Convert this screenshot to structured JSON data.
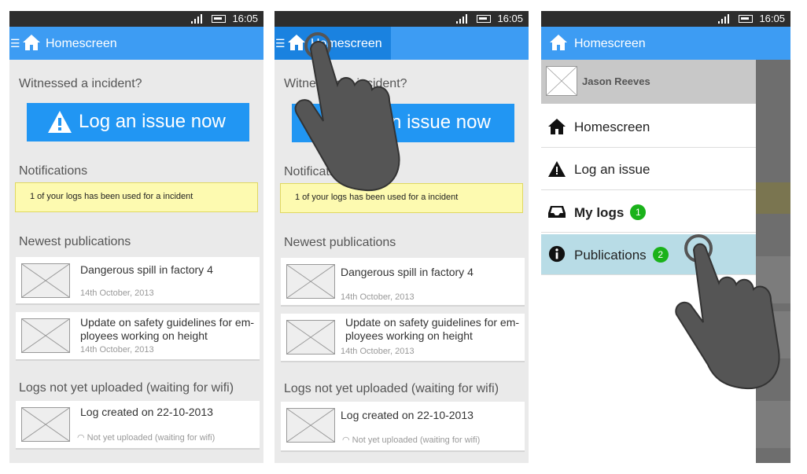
{
  "status": {
    "time": "16:05"
  },
  "appbar": {
    "title": "Homescreen",
    "menu_glyph": "☰"
  },
  "home": {
    "witness_heading": "Witnessed a incident?",
    "log_button": "Log an issue now",
    "notifications_heading": "Notifications",
    "notification_text": "1 of your logs has been used for a incident",
    "publications_heading": "Newest publications",
    "publications": [
      {
        "title": "Dangerous spill in factory 4",
        "date": "14th October, 2013"
      },
      {
        "title": "Update on safety guidelines for em-ployees working on height",
        "date": "14th October, 2013"
      }
    ],
    "pending_heading": "Logs not yet uploaded (waiting for wifi)",
    "pending": [
      {
        "title": "Log created on 22-10-2013",
        "status": "Not yet uploaded (waiting for wifi)"
      }
    ]
  },
  "drawer": {
    "user_name": "Jason Reeves",
    "items": [
      {
        "label": "Homescreen",
        "icon": "home-icon"
      },
      {
        "label": "Log an issue",
        "icon": "warning-icon"
      },
      {
        "label": "My logs",
        "icon": "inbox-icon",
        "badge": "1"
      },
      {
        "label": "Publications",
        "icon": "info-icon",
        "badge": "2"
      }
    ]
  },
  "colors": {
    "appbar": "#3d9cf3",
    "button": "#2196f3",
    "notification": "#fdfab0",
    "badge": "#1ab21a",
    "selected_item": "#b8dce6"
  }
}
